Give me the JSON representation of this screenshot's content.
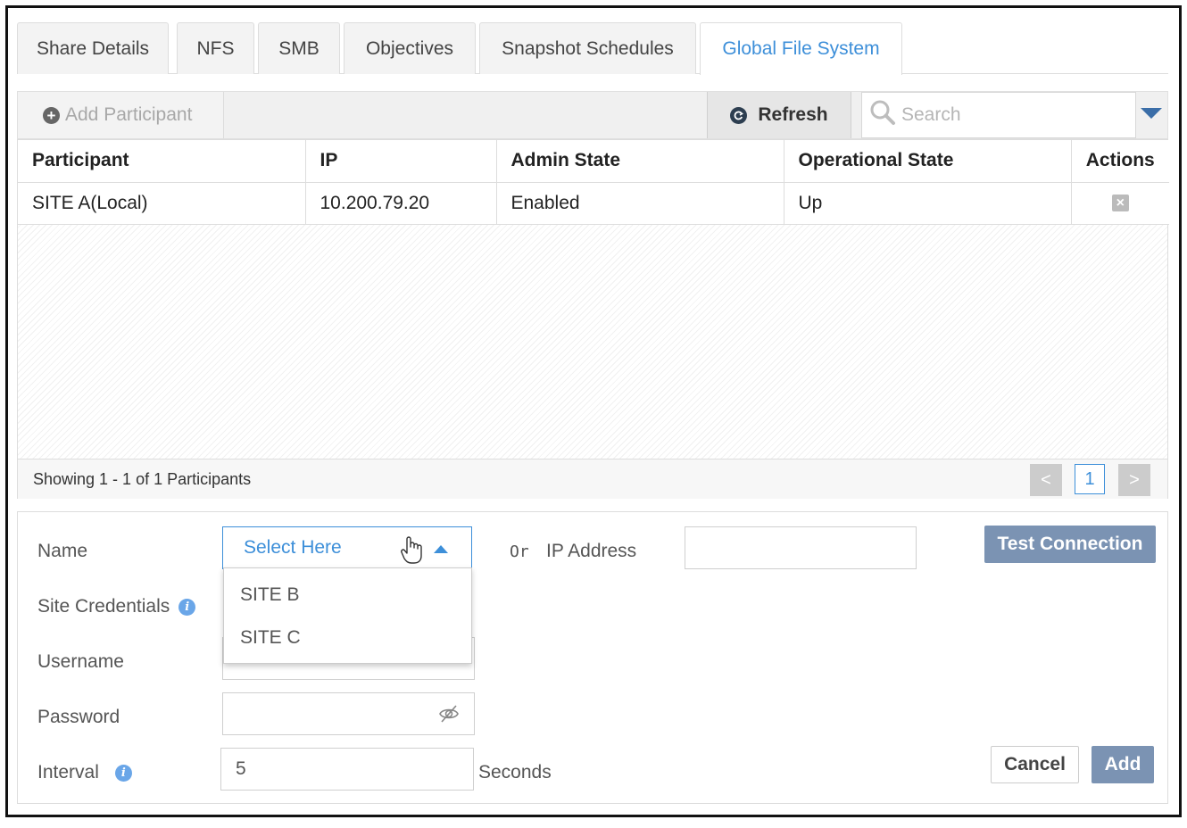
{
  "tabs": [
    {
      "label": "Share Details"
    },
    {
      "label": "NFS"
    },
    {
      "label": "SMB"
    },
    {
      "label": "Objectives"
    },
    {
      "label": "Snapshot Schedules"
    },
    {
      "label": "Global File System",
      "active": true
    }
  ],
  "toolbar": {
    "add_label": "Add Participant",
    "refresh_label": "Refresh",
    "search_placeholder": "Search"
  },
  "table": {
    "columns": [
      "Participant",
      "IP",
      "Admin State",
      "Operational State",
      "Actions"
    ],
    "rows": [
      {
        "participant": "SITE A(Local)",
        "ip": "10.200.79.20",
        "admin_state": "Enabled",
        "operational_state": "Up"
      }
    ],
    "footer_text": "Showing 1 - 1 of 1 Participants",
    "pager": {
      "prev": "<",
      "page": "1",
      "next": ">"
    }
  },
  "form": {
    "name_label": "Name",
    "name_select_value": "Select Here",
    "name_options": [
      "SITE B",
      "SITE C"
    ],
    "or_label": "Or",
    "ip_label": "IP Address",
    "ip_value": "",
    "test_connection_label": "Test Connection",
    "site_credentials_label": "Site Credentials",
    "username_label": "Username",
    "username_value": "",
    "password_label": "Password",
    "password_value": "",
    "interval_label": "Interval",
    "interval_value": "5",
    "interval_unit": "Seconds",
    "cancel_label": "Cancel",
    "add_label": "Add"
  },
  "colors": {
    "accent": "#3d8fd9",
    "primary_button": "#7b93b3",
    "info_icon": "#6aa6e8"
  },
  "icons": [
    "plus-circle-icon",
    "refresh-icon",
    "search-icon",
    "chevron-down-icon",
    "close-box-icon",
    "info-icon",
    "eye-slash-icon",
    "hand-cursor-icon"
  ]
}
